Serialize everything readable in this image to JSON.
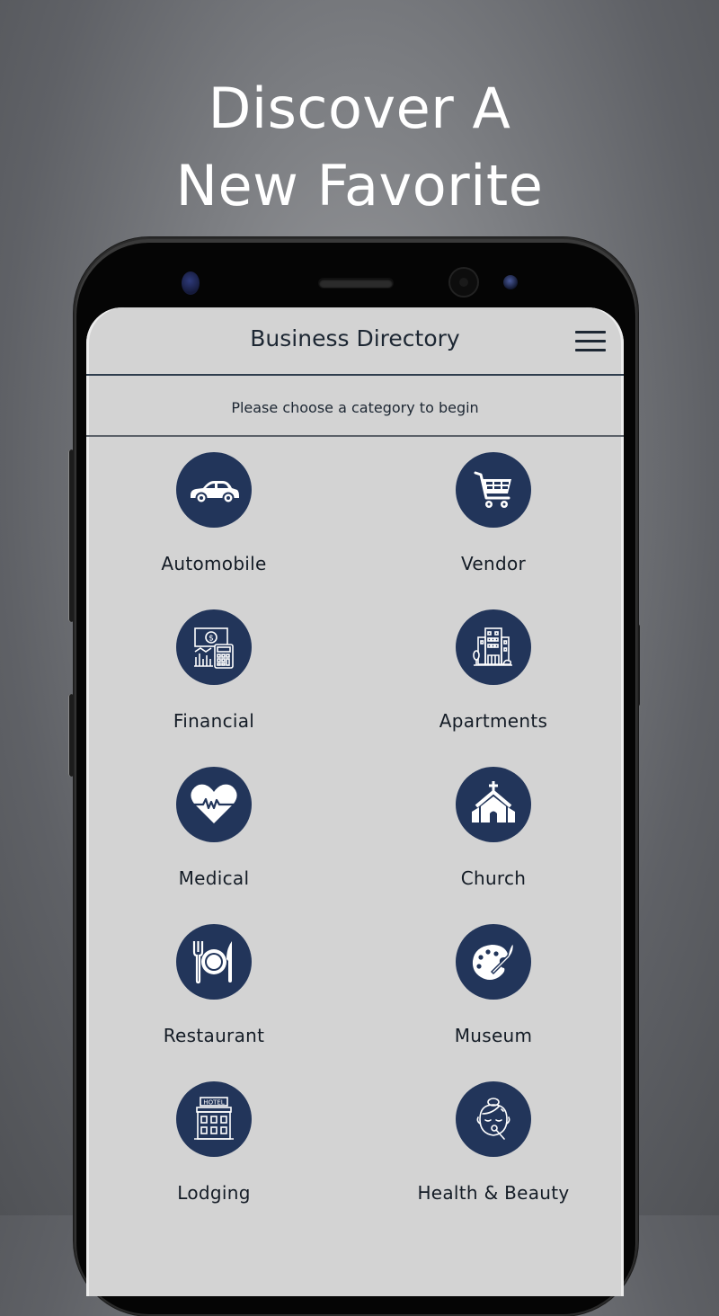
{
  "promo": {
    "headline_line1": "Discover A",
    "headline_line2": "New Favorite"
  },
  "app": {
    "title": "Business Directory",
    "menu_icon": "hamburger-menu-icon",
    "subtitle": "Please choose a category to begin"
  },
  "theme": {
    "icon_circle_color": "#22355a",
    "screen_background": "#d3d3d3",
    "text_color": "#141c26"
  },
  "categories": [
    {
      "label": "Automobile",
      "icon": "car-icon"
    },
    {
      "label": "Vendor",
      "icon": "shopping-cart-icon"
    },
    {
      "label": "Financial",
      "icon": "finance-calculator-icon"
    },
    {
      "label": "Apartments",
      "icon": "apartment-building-icon"
    },
    {
      "label": "Medical",
      "icon": "heartbeat-icon"
    },
    {
      "label": "Church",
      "icon": "church-icon"
    },
    {
      "label": "Restaurant",
      "icon": "plate-cutlery-icon"
    },
    {
      "label": "Museum",
      "icon": "paint-palette-icon"
    },
    {
      "label": "Lodging",
      "icon": "hotel-icon"
    },
    {
      "label": "Health & Beauty",
      "icon": "face-makeup-icon"
    }
  ]
}
